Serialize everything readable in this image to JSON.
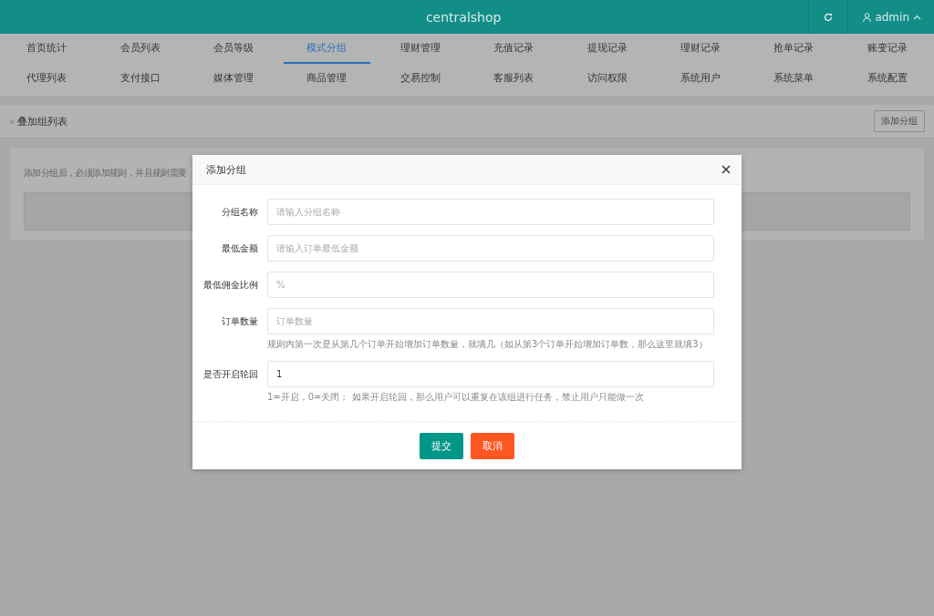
{
  "header": {
    "title": "centralshop",
    "user": "admin"
  },
  "nav": [
    {
      "label": "首页统计",
      "selected": false
    },
    {
      "label": "会员列表",
      "selected": false
    },
    {
      "label": "会员等级",
      "selected": false
    },
    {
      "label": "模式分组",
      "selected": true
    },
    {
      "label": "理财管理",
      "selected": false
    },
    {
      "label": "充值记录",
      "selected": false
    },
    {
      "label": "提现记录",
      "selected": false
    },
    {
      "label": "理财记录",
      "selected": false
    },
    {
      "label": "抢单记录",
      "selected": false
    },
    {
      "label": "账变记录",
      "selected": false
    },
    {
      "label": "代理列表",
      "selected": false
    },
    {
      "label": "支付接口",
      "selected": false
    },
    {
      "label": "媒体管理",
      "selected": false
    },
    {
      "label": "商品管理",
      "selected": false
    },
    {
      "label": "交易控制",
      "selected": false
    },
    {
      "label": "客服列表",
      "selected": false
    },
    {
      "label": "访问权限",
      "selected": false
    },
    {
      "label": "系统用户",
      "selected": false
    },
    {
      "label": "系统菜单",
      "selected": false
    },
    {
      "label": "系统配置",
      "selected": false
    }
  ],
  "breadcrumb": {
    "chevron": "»",
    "title": "叠加组列表",
    "button": "添加分组"
  },
  "notice": "添加分组后，必须添加规则，并且规则需要",
  "dialog": {
    "title": "添加分组",
    "fields": [
      {
        "label": "分组名称",
        "placeholder": "请输入分组名称"
      },
      {
        "label": "最低金额",
        "placeholder": "请输入订单最低金额"
      },
      {
        "label": "最低佣金比例",
        "placeholder": "%"
      },
      {
        "label": "订单数量",
        "placeholder": "订单数量",
        "hint": "规则内第一次是从第几个订单开始增加订单数量，就填几（如从第3个订单开始增加订单数，那么这里就填3）"
      },
      {
        "label": "是否开启轮回",
        "value": "1",
        "hint": "1=开启，0=关闭； 如果开启轮回，那么用户可以重复在该组进行任务，禁止用户只能做一次"
      }
    ],
    "buttons": [
      {
        "label": "提交",
        "kind": "primary"
      },
      {
        "label": "取消",
        "kind": "danger"
      }
    ]
  }
}
